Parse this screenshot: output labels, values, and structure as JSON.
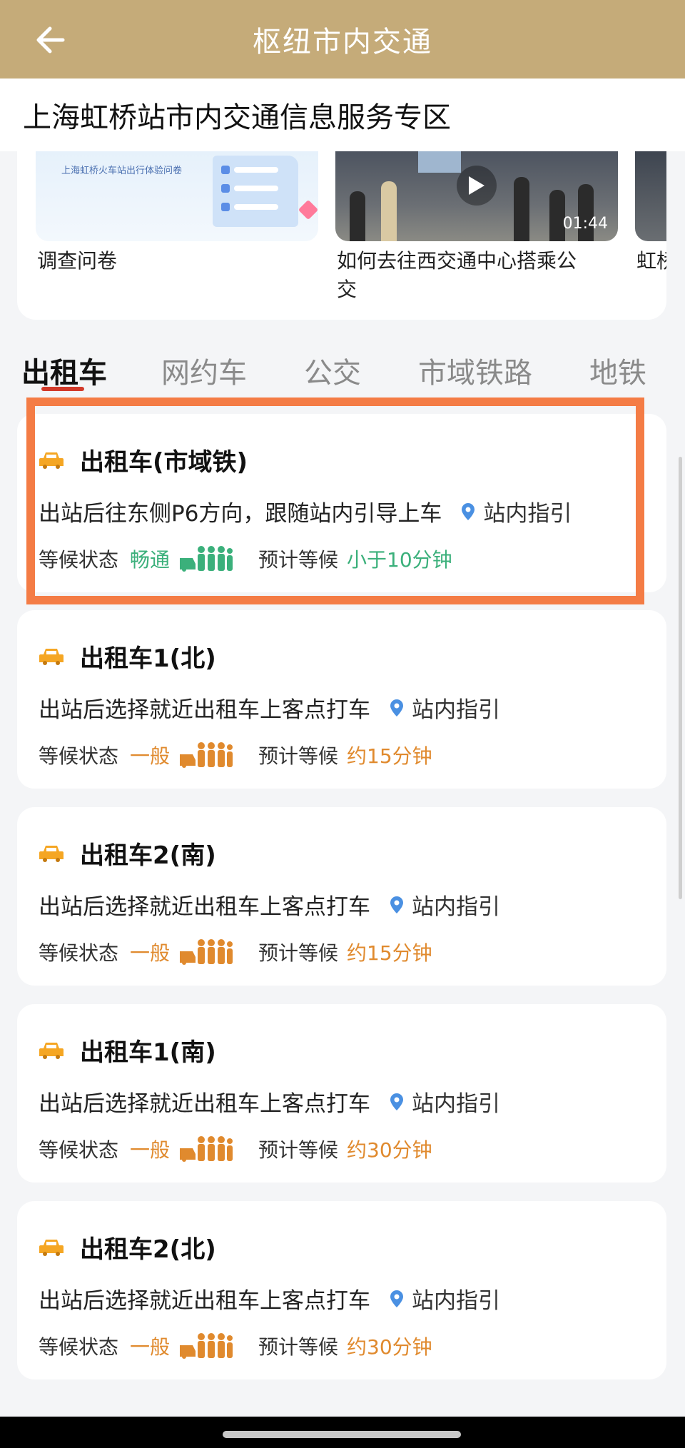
{
  "header": {
    "title": "枢纽市内交通"
  },
  "subheader": {
    "text": "上海虹桥站市内交通信息服务专区"
  },
  "media": {
    "survey": {
      "thumb_text": "上海虹桥火车站出行体验问卷",
      "caption": "调查问卷"
    },
    "video": {
      "duration": "01:44",
      "caption_line1": "如何去往西交通中心搭乘公",
      "caption_line2": "交"
    },
    "partial": {
      "caption": "虹桥"
    }
  },
  "tabs": [
    "出租车",
    "网约车",
    "公交",
    "市域铁路",
    "地铁"
  ],
  "active_tab": "出租车",
  "labels": {
    "status": "等候状态",
    "wait": "预计等候",
    "guide": "站内指引"
  },
  "cards": [
    {
      "title": "出租车(市域铁)",
      "desc": "出站后往东侧P6方向，跟随站内引导上车",
      "status": "畅通",
      "wait": "小于10分钟",
      "color": "#3bb07b"
    },
    {
      "title": "出租车1(北)",
      "desc": "出站后选择就近出租车上客点打车",
      "status": "一般",
      "wait": "约15分钟",
      "color": "#e08a2e"
    },
    {
      "title": "出租车2(南)",
      "desc": "出站后选择就近出租车上客点打车",
      "status": "一般",
      "wait": "约15分钟",
      "color": "#e08a2e"
    },
    {
      "title": "出租车1(南)",
      "desc": "出站后选择就近出租车上客点打车",
      "status": "一般",
      "wait": "约30分钟",
      "color": "#e08a2e"
    },
    {
      "title": "出租车2(北)",
      "desc": "出站后选择就近出租车上客点打车",
      "status": "一般",
      "wait": "约30分钟",
      "color": "#e08a2e"
    }
  ],
  "colors": {
    "header_bg": "#c5ab79",
    "highlight": "#f47c45",
    "tab_underline": "#d23a2a"
  }
}
